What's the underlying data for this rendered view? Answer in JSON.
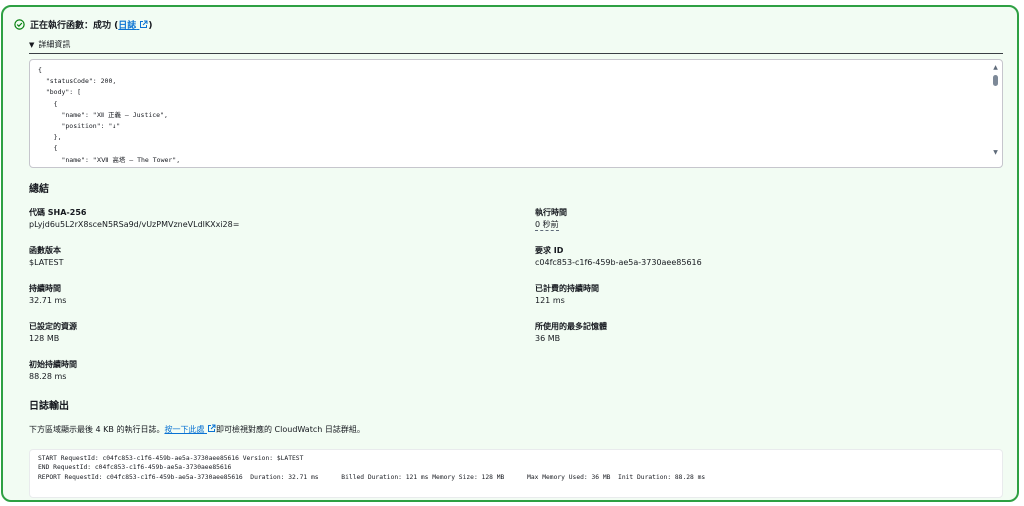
{
  "header": {
    "status_text": "正在執行函數：成功 (",
    "log_link": "日誌",
    "close_paren": ")"
  },
  "details": {
    "toggle_label": "詳細資訊",
    "response_json": "{\n  \"statusCode\": 200,\n  \"body\": [\n    {\n      \"name\": \"Ⅻ 正義 — Justice\",\n      \"position\": \"↓\"\n    },\n    {\n      \"name\": \"ⅩⅦ 高塔 — The Tower\",\n      \"position\": \"↑\""
  },
  "summary": {
    "title": "總結",
    "items": [
      {
        "key": "代碼 SHA-256",
        "value": "pLyjd6u5L2rX8sceN5RSa9d/vUzPMVzneVLdlKXxi28="
      },
      {
        "key": "執行時間",
        "value": "0 秒前"
      },
      {
        "key": "函數版本",
        "value": "$LATEST"
      },
      {
        "key": "要求 ID",
        "value": "c04fc853-c1f6-459b-ae5a-3730aee85616"
      },
      {
        "key": "持續時間",
        "value": "32.71 ms"
      },
      {
        "key": "已計費的持續時間",
        "value": "121 ms"
      },
      {
        "key": "已設定的資源",
        "value": "128 MB"
      },
      {
        "key": "所使用的最多記憶體",
        "value": "36 MB"
      },
      {
        "key": "初始持續時間",
        "value": "88.28 ms"
      }
    ]
  },
  "log_output": {
    "title": "日誌輸出",
    "desc_before": "下方區域顯示最後 4 KB 的執行日誌。",
    "desc_link": "按一下此處",
    "desc_after": "即可檢視對應的 CloudWatch 日誌群組。",
    "log_text": "START RequestId: c04fc853-c1f6-459b-ae5a-3730aee85616 Version: $LATEST\nEND RequestId: c04fc853-c1f6-459b-ae5a-3730aee85616\nREPORT RequestId: c04fc853-c1f6-459b-ae5a-3730aee85616  Duration: 32.71 ms      Billed Duration: 121 ms Memory Size: 128 MB      Max Memory Used: 36 MB  Init Duration: 88.28 ms"
  },
  "colors": {
    "success_border": "#2ea043",
    "success_bg": "#f2fcf3",
    "link": "#0972d3"
  },
  "icons": [
    "check-circle-icon",
    "external-link-icon",
    "caret-down-icon",
    "scroll-up-icon",
    "scroll-down-icon",
    "resize-handle-icon"
  ]
}
